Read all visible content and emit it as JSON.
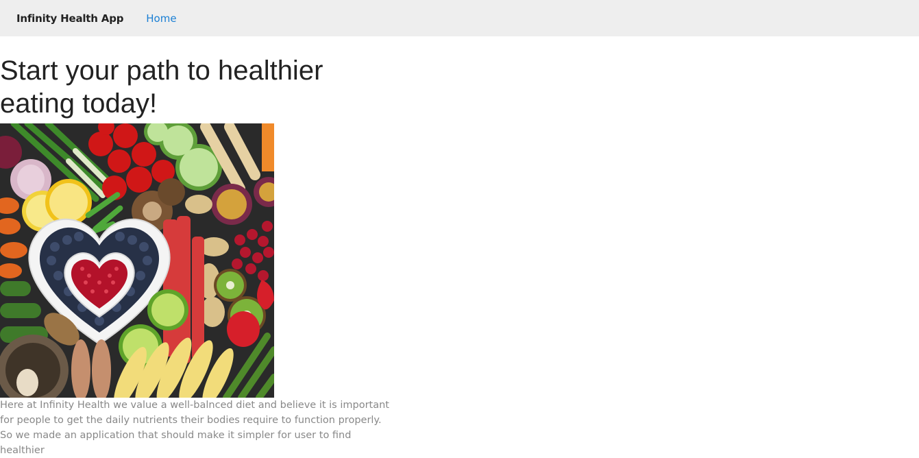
{
  "navbar": {
    "brand": "Infinity Health App",
    "links": [
      {
        "label": "Home"
      }
    ]
  },
  "main": {
    "headline": "Start your path to healthier eating today!",
    "hero_image_icon": "vegetables-heart-bowl-photo",
    "intro": "Here at Infinity Health we value a well-balnced diet and believe it is important for people to get the daily nutrients their bodies require to function properly. So we made an application that should make it simpler for user to find healthier"
  },
  "colors": {
    "navbar_bg": "#eeeeee",
    "link": "#1a7fd4",
    "headline": "#222222",
    "body_text": "#888888"
  }
}
